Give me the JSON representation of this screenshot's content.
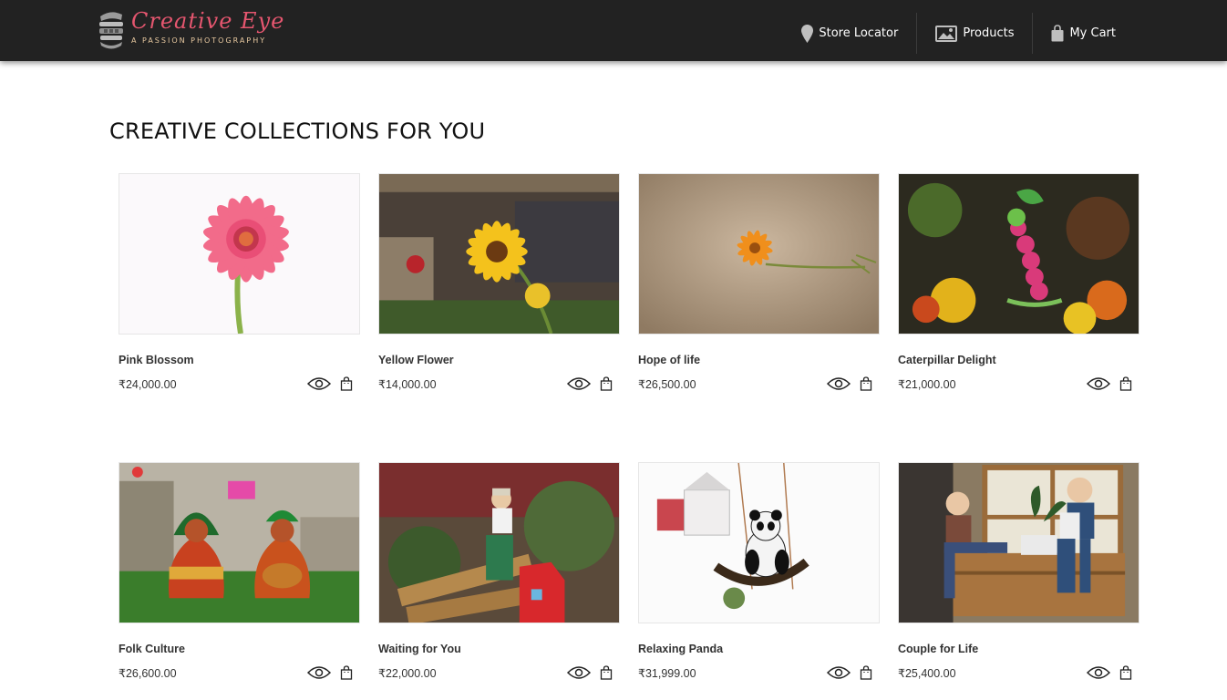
{
  "brand": {
    "name": "Creative Eye",
    "tagline": "A PASSION PHOTOGRAPHY",
    "logo_icon": "camera-lens-icon",
    "accent_color": "#e5566f"
  },
  "nav": {
    "items": [
      {
        "label": "Store Locator",
        "icon": "map-pin-icon"
      },
      {
        "label": "Products",
        "icon": "image-icon"
      },
      {
        "label": "My Cart",
        "icon": "shopping-bag-icon"
      }
    ]
  },
  "main": {
    "title": "CREATIVE COLLECTIONS FOR YOU"
  },
  "products": [
    {
      "name": "Pink Blossom",
      "price": "₹24,000.00"
    },
    {
      "name": "Yellow Flower",
      "price": "₹14,000.00"
    },
    {
      "name": "Hope of life",
      "price": "₹26,500.00"
    },
    {
      "name": "Caterpillar Delight",
      "price": "₹21,000.00"
    },
    {
      "name": "Folk Culture",
      "price": "₹26,600.00"
    },
    {
      "name": "Waiting for You",
      "price": "₹22,000.00"
    },
    {
      "name": "Relaxing Panda",
      "price": "₹31,999.00"
    },
    {
      "name": "Couple for Life",
      "price": "₹25,400.00"
    }
  ],
  "actions": {
    "view_icon": "eye-icon",
    "cart_icon": "shopping-bag-icon"
  },
  "colors": {
    "navbar_bg": "#222222",
    "page_bg": "#ffffff",
    "text": "#333333"
  }
}
